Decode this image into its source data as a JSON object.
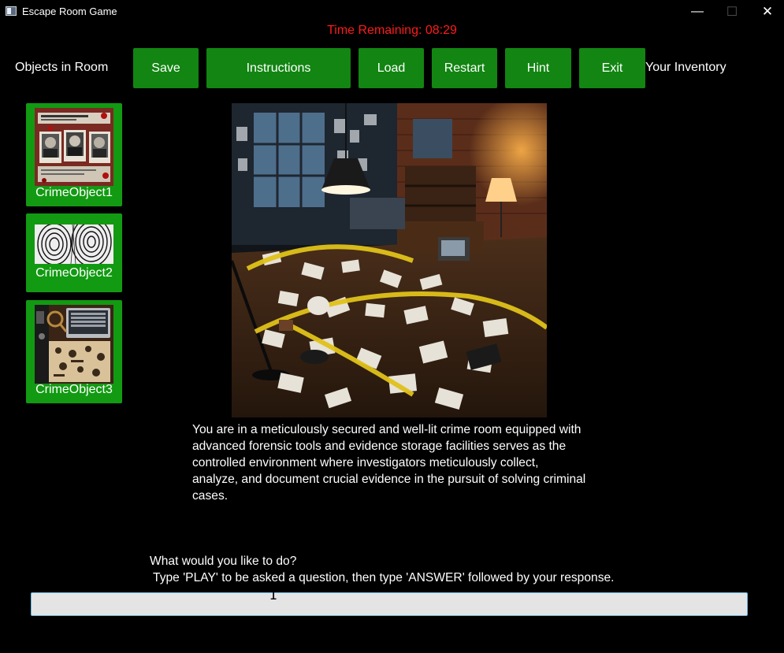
{
  "window": {
    "title": "Escape Room Game",
    "icon": "app-window-icon",
    "controls": {
      "minimize": "—",
      "maximize": "☐",
      "close": "✕"
    }
  },
  "timer": {
    "label": "Time Remaining: 08:29",
    "color": "#ff1a1a"
  },
  "toolbar": {
    "objects_label": "Objects in Room",
    "inventory_label": "Your Inventory",
    "buttons": [
      {
        "label": "Save"
      },
      {
        "label": "Instructions"
      },
      {
        "label": "Load"
      },
      {
        "label": "Restart"
      },
      {
        "label": "Hint"
      },
      {
        "label": "Exit"
      }
    ],
    "button_color": "#128512"
  },
  "objects": [
    {
      "label": "CrimeObject1",
      "thumbnail": "suspect-photos-board"
    },
    {
      "label": "CrimeObject2",
      "thumbnail": "fingerprint-cards"
    },
    {
      "label": "CrimeObject3",
      "thumbnail": "evidence-desk-flatlay"
    }
  ],
  "tile_color": "#129a12",
  "scene": {
    "image": "crime-room-with-caution-tape"
  },
  "description": "You are in a meticulously secured and well-lit crime room equipped with advanced forensic tools and evidence storage facilities serves as the controlled environment where investigators meticulously collect, analyze, and document crucial evidence in the pursuit of solving criminal cases.",
  "prompt": {
    "question": "What would you like to do?",
    "hint": " Type 'PLAY' to be asked a question, then type 'ANSWER' followed by your response."
  },
  "command": {
    "value": "",
    "placeholder": ""
  }
}
